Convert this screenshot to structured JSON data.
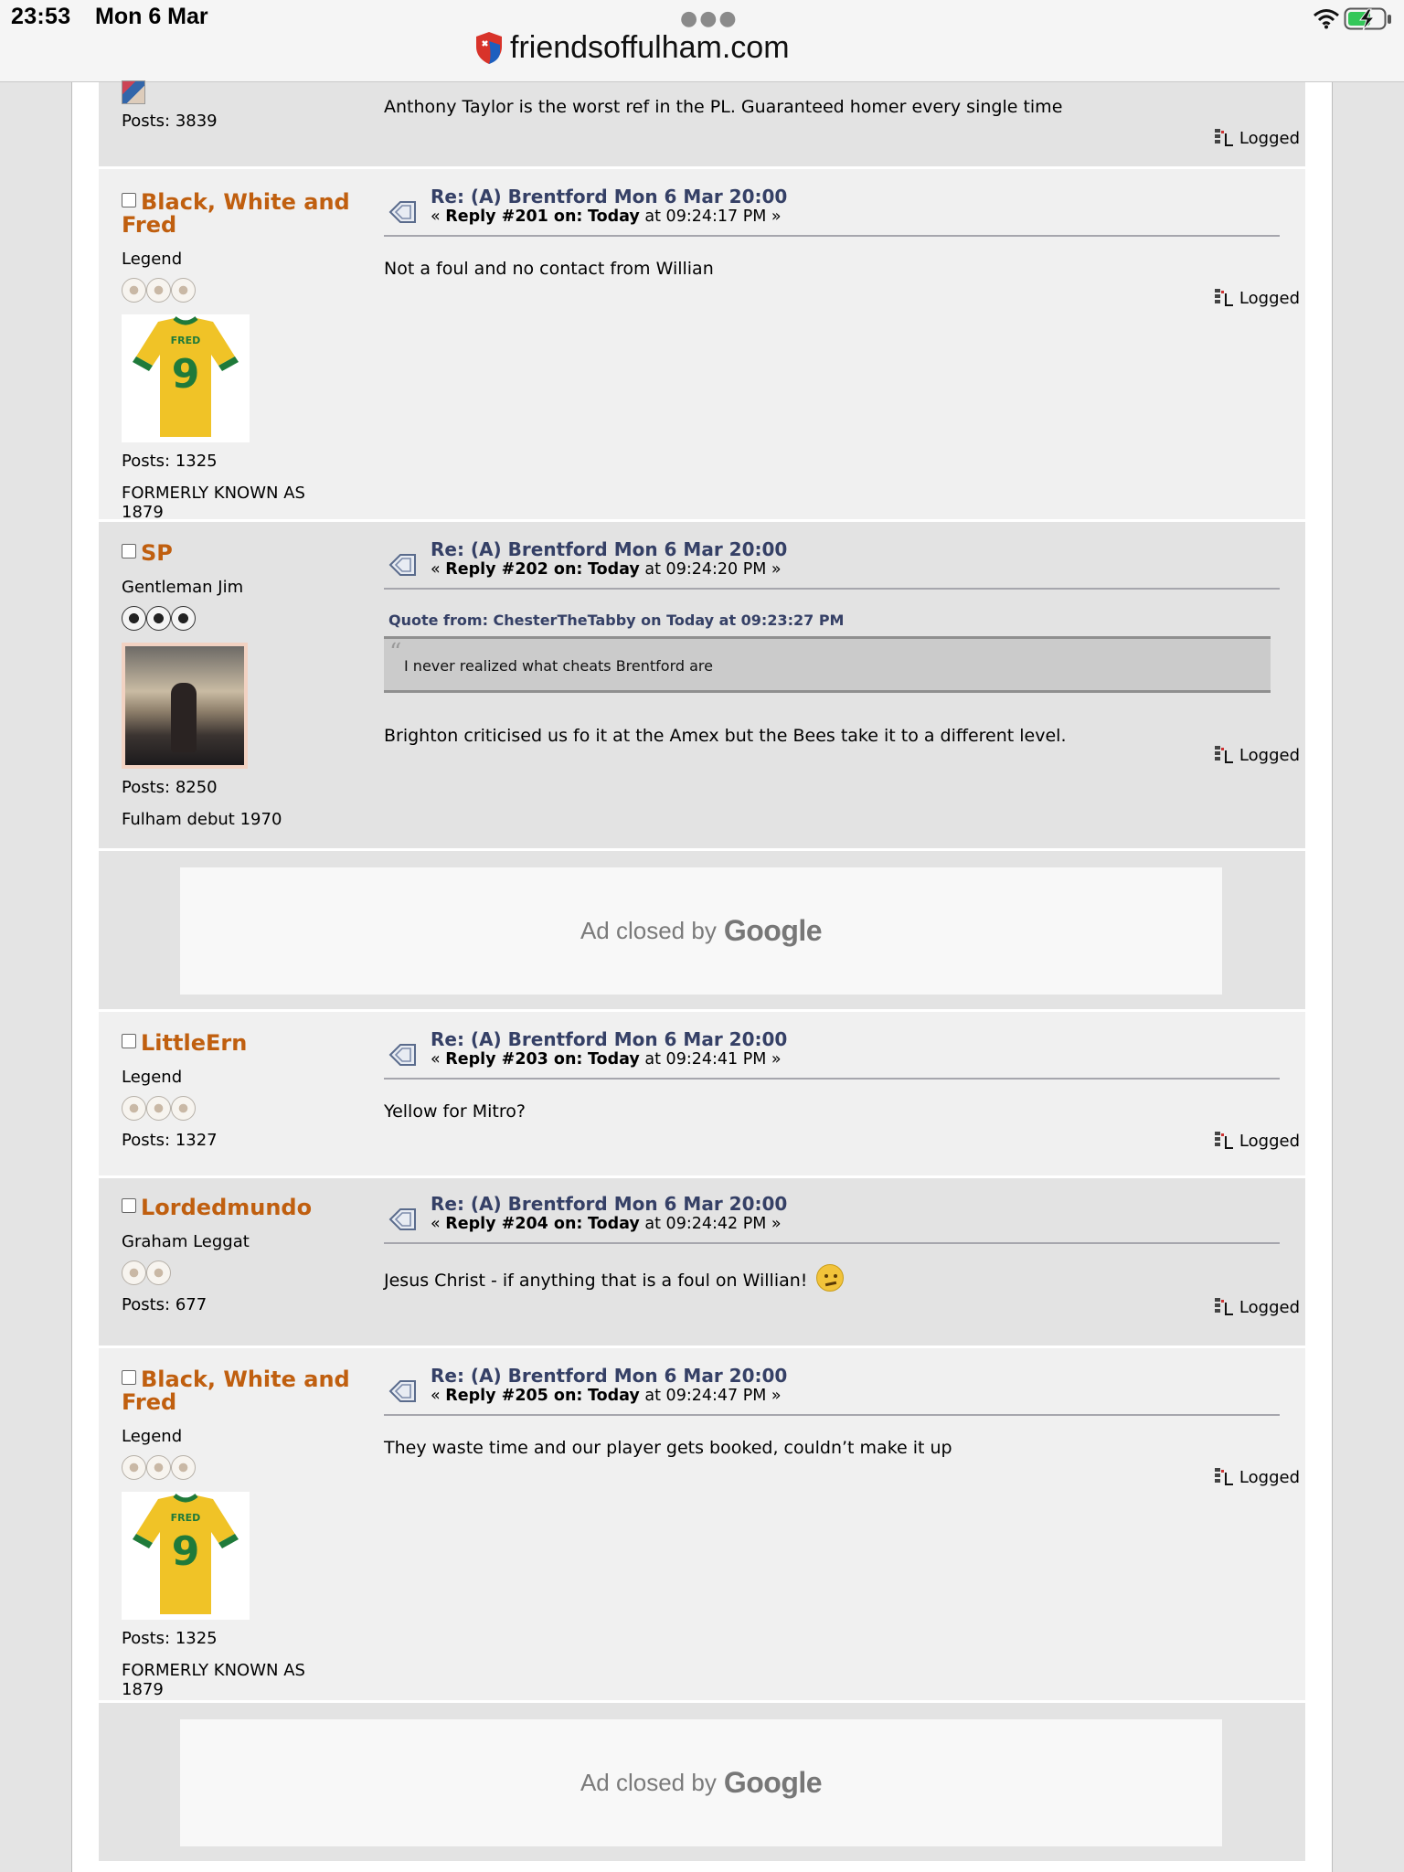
{
  "status_bar": {
    "time": "23:53",
    "date": "Mon 6 Mar",
    "url": "friendsoffulham.com",
    "icons": [
      "wifi-icon",
      "battery-charging-icon",
      "ellipsis-icon",
      "site-shield-icon"
    ]
  },
  "colors": {
    "username": "#c05f0f",
    "subject": "#354066",
    "post_bg_dark": "#e3e3e3",
    "post_bg_light": "#f0f0f0"
  },
  "posts": [
    {
      "posts_count": "Posts: 3839",
      "body": "Anthony Taylor is the worst ref in the PL. Guaranteed homer every single time",
      "logged": "Logged"
    },
    {
      "username": "Black, White and Fred",
      "rank": "Legend",
      "stars": 3,
      "avatar": "fred-9-shirt",
      "posts_count": "Posts: 1325",
      "personal_text": "FORMERLY KNOWN AS 1879",
      "subject": "Re: (A) Brentford Mon 6 Mar 20:00",
      "reply_prefix": "« ",
      "reply_num": "Reply #201 on:",
      "reply_day": "Today",
      "reply_time": " at 09:24:17 PM »",
      "body": "Not a foul and no contact from Willian",
      "logged": "Logged"
    },
    {
      "username": "SP",
      "rank": "Gentleman Jim",
      "stars": 3,
      "avatar": "photo-figure",
      "posts_count": "Posts: 8250",
      "personal_text": "Fulham debut 1970",
      "subject": "Re: (A) Brentford Mon 6 Mar 20:00",
      "reply_prefix": "« ",
      "reply_num": "Reply #202 on:",
      "reply_day": "Today",
      "reply_time": " at 09:24:20 PM »",
      "quote_header": "Quote from: ChesterTheTabby on Today at 09:23:27 PM",
      "quote_text": "I never realized what cheats Brentford are",
      "body": "Brighton criticised us fo it at the Amex but the Bees take it to a different level.",
      "logged": "Logged"
    },
    {
      "username": "LittleErn",
      "rank": "Legend",
      "stars": 3,
      "posts_count": "Posts: 1327",
      "subject": "Re: (A) Brentford Mon 6 Mar 20:00",
      "reply_prefix": "« ",
      "reply_num": "Reply #203 on:",
      "reply_day": "Today",
      "reply_time": " at 09:24:41 PM »",
      "body": "Yellow for Mitro?",
      "logged": "Logged"
    },
    {
      "username": "Lordedmundo",
      "rank": "Graham Leggat",
      "stars": 2,
      "posts_count": "Posts: 677",
      "subject": "Re: (A) Brentford Mon 6 Mar 20:00",
      "reply_prefix": "« ",
      "reply_num": "Reply #204 on:",
      "reply_day": "Today",
      "reply_time": " at 09:24:42 PM »",
      "body": "Jesus Christ - if anything that is a foul on Willian!",
      "body_emoji": "annoyed-face-emoji",
      "logged": "Logged"
    },
    {
      "username": "Black, White and Fred",
      "rank": "Legend",
      "stars": 3,
      "avatar": "fred-9-shirt",
      "posts_count": "Posts: 1325",
      "personal_text": "FORMERLY KNOWN AS 1879",
      "subject": "Re: (A) Brentford Mon 6 Mar 20:00",
      "reply_prefix": "« ",
      "reply_num": "Reply #205 on:",
      "reply_day": "Today",
      "reply_time": " at 09:24:47 PM »",
      "body": "They waste time and our player gets booked, couldn’t make it up",
      "logged": "Logged"
    }
  ],
  "ads": [
    {
      "text": "Ad closed by",
      "brand": "Google"
    },
    {
      "text": "Ad closed by",
      "brand": "Google"
    }
  ]
}
